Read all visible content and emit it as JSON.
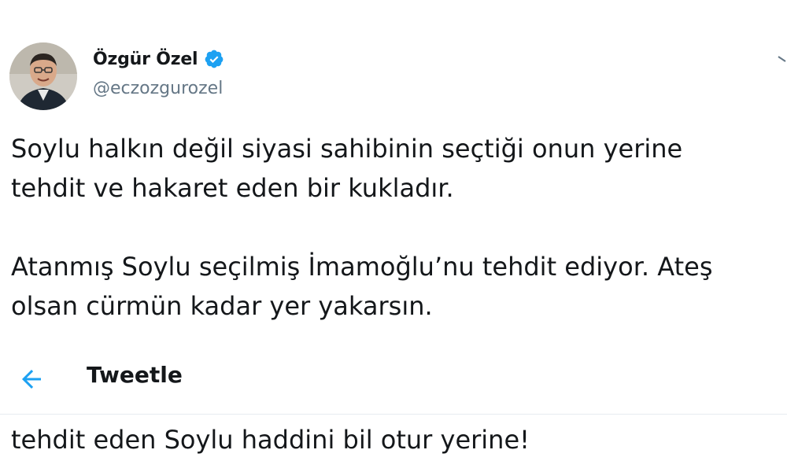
{
  "user": {
    "display_name": "Özgür Özel",
    "handle": "@eczozgurozel",
    "verified": true,
    "avatar_icon": "profile-photo"
  },
  "tweet": {
    "paragraphs": [
      [
        "Soylu halkın değil siyasi sahibinin seçtiği onun yerine",
        "tehdit ve hakaret eden bir kukladır."
      ],
      [
        "Atanmış Soylu seçilmiş İmamoğlu’nu tehdit ediyor. Ateş",
        "olsan cürmün kadar yer yakarsın."
      ]
    ]
  },
  "compose": {
    "title": "Tweetle",
    "back_icon": "arrow-left-icon",
    "text": "tehdit eden Soylu haddini bil otur yerine!"
  },
  "colors": {
    "accent": "#1da1f2",
    "text": "#14171a",
    "secondary_text": "#657786",
    "divider": "#e6ecf0"
  }
}
